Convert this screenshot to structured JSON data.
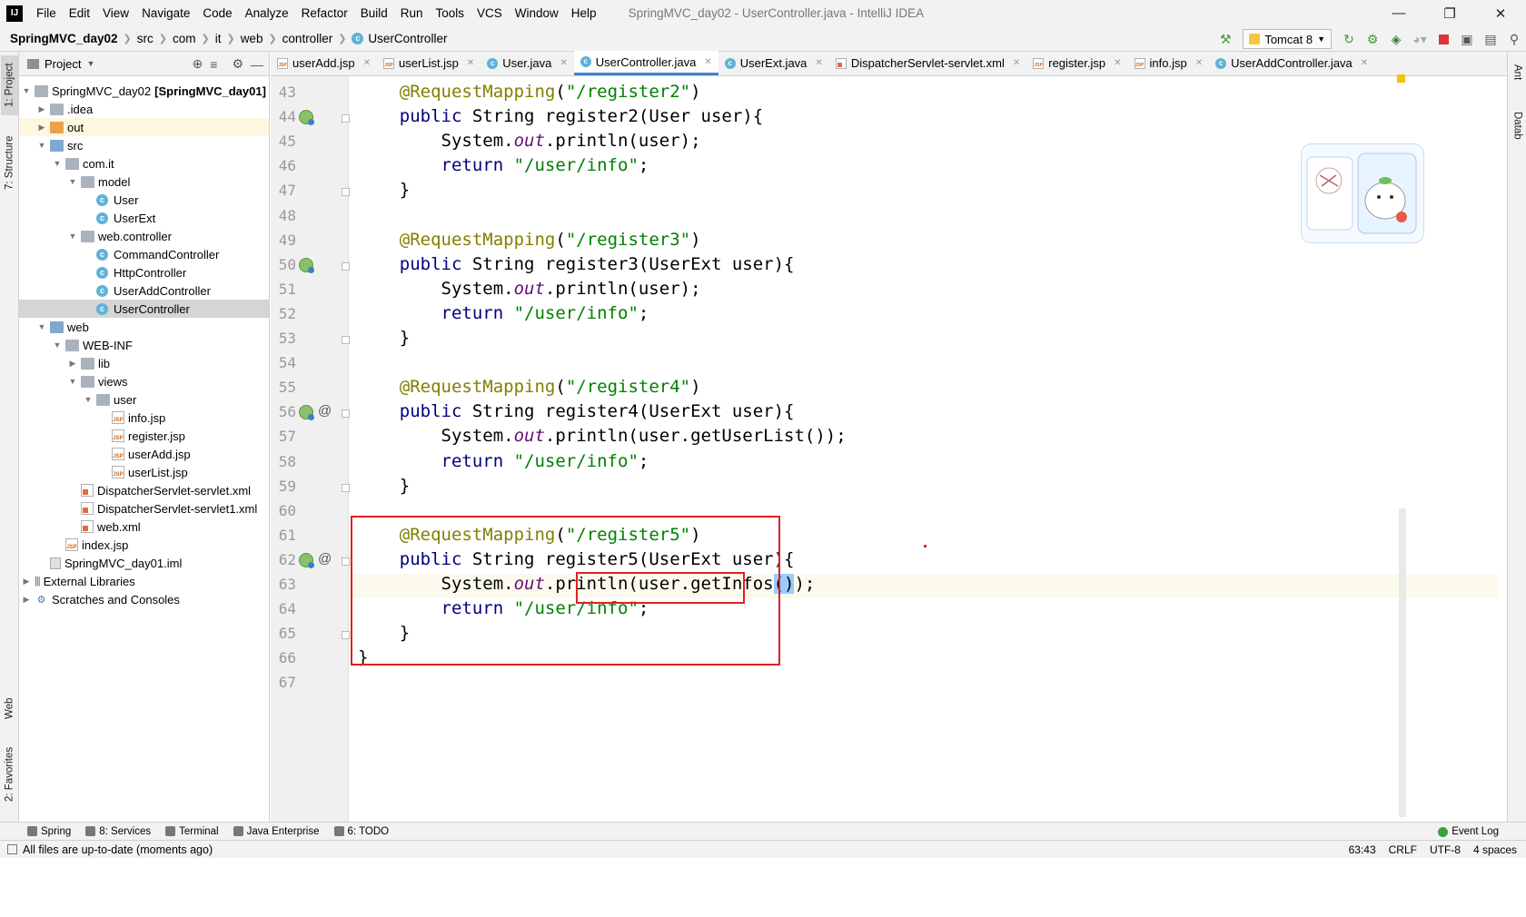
{
  "menubar": {
    "logo": "IJ",
    "items": [
      "File",
      "Edit",
      "View",
      "Navigate",
      "Code",
      "Analyze",
      "Refactor",
      "Build",
      "Run",
      "Tools",
      "VCS",
      "Window",
      "Help"
    ],
    "window_title": "SpringMVC_day02 - UserController.java - IntelliJ IDEA"
  },
  "navbar": {
    "breadcrumb": [
      "SpringMVC_day02",
      "src",
      "com",
      "it",
      "web",
      "controller",
      "UserController"
    ],
    "run_config": "Tomcat 8"
  },
  "left_stripe": {
    "project": "1: Project",
    "structure": "7: Structure",
    "web": "Web",
    "favorites": "2: Favorites"
  },
  "right_stripe": {
    "ant": "Ant",
    "database": "Datab"
  },
  "project_panel": {
    "title": "Project",
    "tree": [
      {
        "label": "SpringMVC_day02",
        "suffix": "[SpringMVC_day01]",
        "indent": 0,
        "arrow": "▼",
        "icon": "folder"
      },
      {
        "label": ".idea",
        "indent": 1,
        "arrow": "▶",
        "icon": "folder"
      },
      {
        "label": "out",
        "indent": 1,
        "arrow": "▶",
        "icon": "folder-orange",
        "state": "excluded"
      },
      {
        "label": "src",
        "indent": 1,
        "arrow": "▼",
        "icon": "folder-blue"
      },
      {
        "label": "com.it",
        "indent": 2,
        "arrow": "▼",
        "icon": "folder"
      },
      {
        "label": "model",
        "indent": 3,
        "arrow": "▼",
        "icon": "folder"
      },
      {
        "label": "User",
        "indent": 4,
        "arrow": "",
        "icon": "class"
      },
      {
        "label": "UserExt",
        "indent": 4,
        "arrow": "",
        "icon": "class"
      },
      {
        "label": "web.controller",
        "indent": 3,
        "arrow": "▼",
        "icon": "folder"
      },
      {
        "label": "CommandController",
        "indent": 4,
        "arrow": "",
        "icon": "class"
      },
      {
        "label": "HttpController",
        "indent": 4,
        "arrow": "",
        "icon": "class"
      },
      {
        "label": "UserAddController",
        "indent": 4,
        "arrow": "",
        "icon": "class"
      },
      {
        "label": "UserController",
        "indent": 4,
        "arrow": "",
        "icon": "class",
        "state": "selected"
      },
      {
        "label": "web",
        "indent": 1,
        "arrow": "▼",
        "icon": "folder-blue"
      },
      {
        "label": "WEB-INF",
        "indent": 2,
        "arrow": "▼",
        "icon": "folder"
      },
      {
        "label": "lib",
        "indent": 3,
        "arrow": "▶",
        "icon": "folder"
      },
      {
        "label": "views",
        "indent": 3,
        "arrow": "▼",
        "icon": "folder"
      },
      {
        "label": "user",
        "indent": 4,
        "arrow": "▼",
        "icon": "folder"
      },
      {
        "label": "info.jsp",
        "indent": 5,
        "arrow": "",
        "icon": "jsp"
      },
      {
        "label": "register.jsp",
        "indent": 5,
        "arrow": "",
        "icon": "jsp"
      },
      {
        "label": "userAdd.jsp",
        "indent": 5,
        "arrow": "",
        "icon": "jsp"
      },
      {
        "label": "userList.jsp",
        "indent": 5,
        "arrow": "",
        "icon": "jsp"
      },
      {
        "label": "DispatcherServlet-servlet.xml",
        "indent": 3,
        "arrow": "",
        "icon": "xml"
      },
      {
        "label": "DispatcherServlet-servlet1.xml",
        "indent": 3,
        "arrow": "",
        "icon": "xml"
      },
      {
        "label": "web.xml",
        "indent": 3,
        "arrow": "",
        "icon": "xml"
      },
      {
        "label": "index.jsp",
        "indent": 2,
        "arrow": "",
        "icon": "jsp"
      },
      {
        "label": "SpringMVC_day01.iml",
        "indent": 1,
        "arrow": "",
        "icon": "iml"
      },
      {
        "label": "External Libraries",
        "indent": 0,
        "arrow": "▶",
        "icon": "lib"
      },
      {
        "label": "Scratches and Consoles",
        "indent": 0,
        "arrow": "▶",
        "icon": "scratch"
      }
    ]
  },
  "editor_tabs": [
    {
      "label": "userAdd.jsp",
      "type": "jsp"
    },
    {
      "label": "userList.jsp",
      "type": "jsp"
    },
    {
      "label": "User.java",
      "type": "class"
    },
    {
      "label": "UserController.java",
      "type": "class",
      "active": true
    },
    {
      "label": "UserExt.java",
      "type": "class"
    },
    {
      "label": "DispatcherServlet-servlet.xml",
      "type": "xml"
    },
    {
      "label": "register.jsp",
      "type": "jsp"
    },
    {
      "label": "info.jsp",
      "type": "jsp"
    },
    {
      "label": "UserAddController.java",
      "type": "class",
      "noclose": false
    }
  ],
  "editor": {
    "lines": [
      {
        "n": "43",
        "tokens": [
          [
            "    ",
            ""
          ],
          [
            "@RequestMapping",
            "ann"
          ],
          [
            "(",
            ""
          ],
          [
            "\"/register2\"",
            "str"
          ],
          [
            ")",
            ""
          ]
        ]
      },
      {
        "n": "44",
        "bean": true,
        "fold": true,
        "tokens": [
          [
            "    ",
            ""
          ],
          [
            "public",
            "kw"
          ],
          [
            " String ",
            ""
          ],
          [
            "register2",
            "meth"
          ],
          [
            "(User user){",
            ""
          ]
        ]
      },
      {
        "n": "45",
        "tokens": [
          [
            "        System.",
            ""
          ],
          [
            "out",
            "fld"
          ],
          [
            ".println(user);",
            ""
          ]
        ]
      },
      {
        "n": "46",
        "tokens": [
          [
            "        ",
            ""
          ],
          [
            "return",
            "kw"
          ],
          [
            " ",
            ""
          ],
          [
            "\"/user/info\"",
            "str"
          ],
          [
            ";",
            ""
          ]
        ]
      },
      {
        "n": "47",
        "fold": true,
        "tokens": [
          [
            "    }",
            ""
          ]
        ]
      },
      {
        "n": "48",
        "tokens": []
      },
      {
        "n": "49",
        "tokens": [
          [
            "    ",
            ""
          ],
          [
            "@RequestMapping",
            "ann"
          ],
          [
            "(",
            ""
          ],
          [
            "\"/register3\"",
            "str"
          ],
          [
            ")",
            ""
          ]
        ]
      },
      {
        "n": "50",
        "bean": true,
        "fold": true,
        "tokens": [
          [
            "    ",
            ""
          ],
          [
            "public",
            "kw"
          ],
          [
            " String ",
            ""
          ],
          [
            "register3",
            "meth"
          ],
          [
            "(UserExt user){",
            ""
          ]
        ]
      },
      {
        "n": "51",
        "tokens": [
          [
            "        System.",
            ""
          ],
          [
            "out",
            "fld"
          ],
          [
            ".println(user);",
            ""
          ]
        ]
      },
      {
        "n": "52",
        "tokens": [
          [
            "        ",
            ""
          ],
          [
            "return",
            "kw"
          ],
          [
            " ",
            ""
          ],
          [
            "\"/user/info\"",
            "str"
          ],
          [
            ";",
            ""
          ]
        ]
      },
      {
        "n": "53",
        "fold": true,
        "tokens": [
          [
            "    }",
            ""
          ]
        ]
      },
      {
        "n": "54",
        "tokens": []
      },
      {
        "n": "55",
        "tokens": [
          [
            "    ",
            ""
          ],
          [
            "@RequestMapping",
            "ann"
          ],
          [
            "(",
            ""
          ],
          [
            "\"/register4\"",
            "str"
          ],
          [
            ")",
            ""
          ]
        ]
      },
      {
        "n": "56",
        "bean": true,
        "at": true,
        "fold": true,
        "tokens": [
          [
            "    ",
            ""
          ],
          [
            "public",
            "kw"
          ],
          [
            " String ",
            ""
          ],
          [
            "register4",
            "meth"
          ],
          [
            "(UserExt user){",
            ""
          ]
        ]
      },
      {
        "n": "57",
        "tokens": [
          [
            "        System.",
            ""
          ],
          [
            "out",
            "fld"
          ],
          [
            ".println(user.getUserList());",
            ""
          ]
        ]
      },
      {
        "n": "58",
        "tokens": [
          [
            "        ",
            ""
          ],
          [
            "return",
            "kw"
          ],
          [
            " ",
            ""
          ],
          [
            "\"/user/info\"",
            "str"
          ],
          [
            ";",
            ""
          ]
        ]
      },
      {
        "n": "59",
        "fold": true,
        "tokens": [
          [
            "    }",
            ""
          ]
        ]
      },
      {
        "n": "60",
        "tokens": []
      },
      {
        "n": "61",
        "tokens": [
          [
            "    ",
            ""
          ],
          [
            "@RequestMapping",
            "ann"
          ],
          [
            "(",
            ""
          ],
          [
            "\"/register5\"",
            "str"
          ],
          [
            ")",
            ""
          ]
        ]
      },
      {
        "n": "62",
        "bean": true,
        "at": true,
        "fold": true,
        "tokens": [
          [
            "    ",
            ""
          ],
          [
            "public",
            "kw"
          ],
          [
            " String ",
            ""
          ],
          [
            "register5",
            "meth"
          ],
          [
            "(UserExt user){",
            ""
          ]
        ]
      },
      {
        "n": "63",
        "caret": true,
        "tokens": [
          [
            "        System.",
            ""
          ],
          [
            "out",
            "fld"
          ],
          [
            ".println(user.getInfos",
            ""
          ],
          [
            "()",
            "paren"
          ],
          [
            ");",
            ""
          ]
        ]
      },
      {
        "n": "64",
        "tokens": [
          [
            "        ",
            ""
          ],
          [
            "return",
            "kw"
          ],
          [
            " ",
            ""
          ],
          [
            "\"/user/info\"",
            "str"
          ],
          [
            ";",
            ""
          ]
        ]
      },
      {
        "n": "65",
        "fold": true,
        "tokens": [
          [
            "    }",
            ""
          ]
        ]
      },
      {
        "n": "66",
        "tokens": [
          [
            "}",
            ""
          ]
        ]
      },
      {
        "n": "67",
        "tokens": []
      }
    ]
  },
  "toolwindows": [
    {
      "label": "Spring"
    },
    {
      "label": "8: Services"
    },
    {
      "label": "Terminal"
    },
    {
      "label": "Java Enterprise"
    },
    {
      "label": "6: TODO"
    }
  ],
  "event_log": "Event Log",
  "status": {
    "message": "All files are up-to-date (moments ago)",
    "position": "63:43",
    "line_sep": "CRLF",
    "encoding": "UTF-8",
    "indent": "4 spaces"
  },
  "colors": {
    "accent": "#4083c9",
    "highlight_box": "#e02020",
    "annotation": "#808000",
    "string": "#008000",
    "keyword": "#000080"
  }
}
